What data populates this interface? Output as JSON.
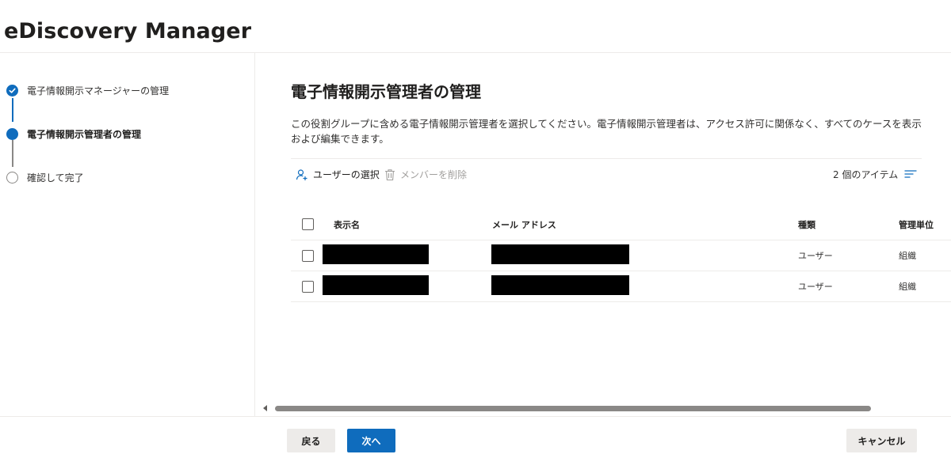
{
  "app": {
    "title": "eDiscovery Manager"
  },
  "steps": [
    {
      "label": "電子情報開示マネージャーの管理",
      "state": "done"
    },
    {
      "label": "電子情報開示管理者の管理",
      "state": "current"
    },
    {
      "label": "確認して完了",
      "state": "pending"
    }
  ],
  "main": {
    "title": "電子情報開示管理者の管理",
    "description": "この役割グループに含める電子情報開示管理者を選択してください。電子情報開示管理者は、アクセス許可に関係なく、すべてのケースを表示および編集できます。"
  },
  "commands": {
    "select_users": "ユーザーの選択",
    "remove_members": "メンバーを削除",
    "item_count": "2 個のアイテム"
  },
  "table": {
    "columns": [
      "表示名",
      "メール アドレス",
      "種類",
      "管理単位"
    ],
    "rows": [
      {
        "type": "ユーザー",
        "unit": "組織"
      },
      {
        "type": "ユーザー",
        "unit": "組織"
      }
    ]
  },
  "footer": {
    "back_label": "戻る",
    "next_label": "次へ",
    "cancel_label": "キャンセル"
  },
  "colors": {
    "accent": "#0f6cbd",
    "divider": "#edebe9",
    "secondary_button": "#edebe9"
  },
  "icons": {
    "step_done": "checkmark-circle-icon",
    "select_users": "person-add-icon",
    "remove_members": "trash-icon",
    "view_options": "lines-icon"
  }
}
